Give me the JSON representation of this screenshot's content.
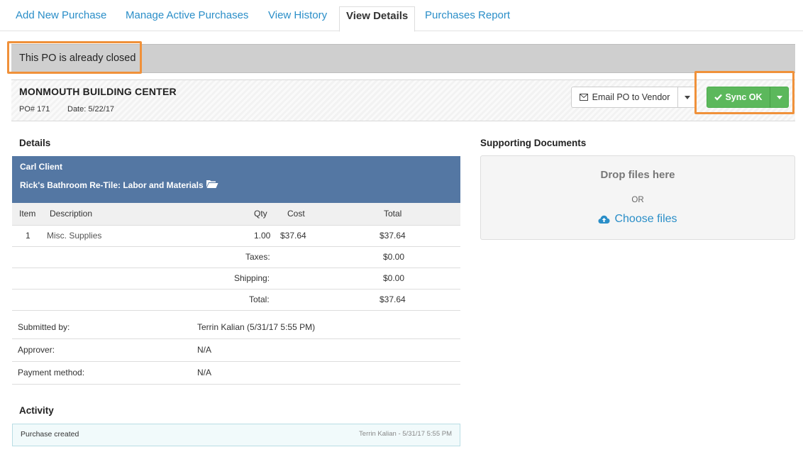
{
  "nav": {
    "tabs": [
      {
        "label": "Add New Purchase"
      },
      {
        "label": "Manage Active Purchases"
      },
      {
        "label": "View History"
      },
      {
        "label": "View Details",
        "active": true
      },
      {
        "label": "Purchases Report"
      }
    ]
  },
  "banner": {
    "text": "This PO is already closed"
  },
  "vendor": {
    "name": "MONMOUTH BUILDING CENTER",
    "po_number": "PO# 171",
    "date": "Date: 5/22/17"
  },
  "actions": {
    "email_label": "Email PO to Vendor",
    "sync_label": "Sync OK"
  },
  "details": {
    "title": "Details",
    "client": "Carl Client",
    "project": "Rick's Bathroom Re-Tile: Labor and Materials",
    "columns": {
      "item": "Item",
      "description": "Description",
      "qty": "Qty",
      "cost": "Cost",
      "total": "Total"
    },
    "items": [
      {
        "item": "1",
        "description": "Misc. Supplies",
        "qty": "1.00",
        "cost": "$37.64",
        "total": "$37.64"
      }
    ],
    "taxes_label": "Taxes:",
    "taxes": "$0.00",
    "shipping_label": "Shipping:",
    "shipping": "$0.00",
    "total_label": "Total:",
    "total": "$37.64"
  },
  "meta": {
    "submitted_label": "Submitted by:",
    "submitted": "Terrin Kalian (5/31/17 5:55 PM)",
    "approver_label": "Approver:",
    "approver": "N/A",
    "payment_label": "Payment method:",
    "payment": "N/A"
  },
  "activity": {
    "title": "Activity",
    "entries": [
      {
        "text": "Purchase created",
        "meta": "Terrin Kalian - 5/31/17 5:55 PM"
      }
    ]
  },
  "supporting": {
    "title": "Supporting Documents",
    "drop_text": "Drop files here",
    "or_text": "OR",
    "choose_text": "Choose files"
  },
  "colors": {
    "accent": "#2a8ec8",
    "success": "#5cb85c",
    "project_header": "#5477a3",
    "highlight": "#f0913a"
  }
}
